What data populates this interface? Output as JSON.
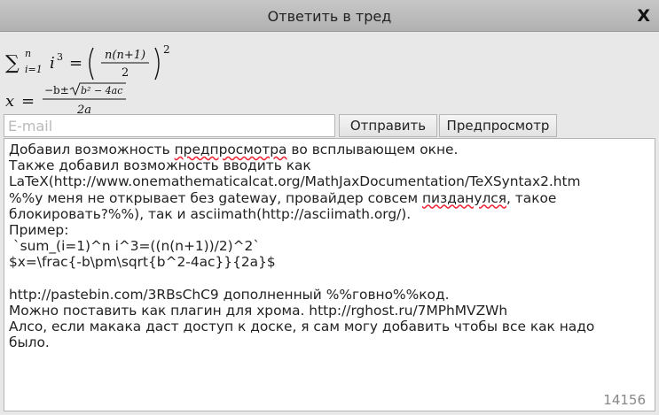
{
  "dialog": {
    "title": "Ответить в тред",
    "close_label": "X"
  },
  "preview": {
    "formula1": {
      "sum": "∑",
      "lower": "i=1",
      "upper": "n",
      "base": "i",
      "exp": "3",
      "eq": "=",
      "numerator": "n(n+1)",
      "denominator": "2",
      "outer_exp": "2"
    },
    "formula2": {
      "lhs": "x",
      "eq": "=",
      "numerator_prefix": "−b±",
      "radicand": "b² − 4ac",
      "denominator": "2a"
    }
  },
  "form": {
    "email_placeholder": "E-mail",
    "email_value": "",
    "send_label": "Отправить",
    "preview_label": "Предпросмотр"
  },
  "message": {
    "lines": [
      [
        "Добавил возможность ",
        {
          "spell": "предпросмотра"
        },
        " во всплывающем окне."
      ],
      [
        "Также добавил возможность вводить как"
      ],
      [
        "LaTeX(http://www.onemathematicalcat.org/MathJaxDocumentation/TeXSyntax2.htm"
      ],
      [
        "%%у меня не открывает без gateway, провайдер совсем ",
        {
          "spell": "пизданулся"
        },
        ", такое"
      ],
      [
        "блокировать?%%), так и asciimath(http://asciimath.org/)."
      ],
      [
        "Пример:"
      ],
      [
        " `sum_(i=1)^n i^3=((n(n+1))/2)^2`"
      ],
      [
        "$x=\\frac{-b\\pm\\sqrt{b^2-4ac}}{2a}$"
      ],
      [
        ""
      ],
      [
        "http://pastebin.com/3RBsChC9 дополненный %%говно%%код."
      ],
      [
        "Можно поставить как плагин для хрома. http://rghost.ru/7MPhMVZWh"
      ],
      [
        "Алсо, если макака даст доступ к доске, я сам могу добавить чтобы все как надо"
      ],
      [
        "было."
      ]
    ],
    "char_counter": "14156"
  }
}
